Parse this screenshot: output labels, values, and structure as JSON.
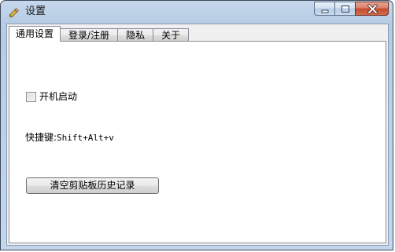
{
  "window": {
    "title": "设置",
    "icon": "pencil-icon",
    "controls": {
      "minimize": "minimize-icon",
      "maximize": "maximize-icon",
      "close": "close-icon"
    }
  },
  "tabs": [
    {
      "label": "通用设置",
      "active": true
    },
    {
      "label": "登录/注册",
      "active": false
    },
    {
      "label": "隐私",
      "active": false
    },
    {
      "label": "关于",
      "active": false
    }
  ],
  "general": {
    "autostart_label": "开机启动",
    "autostart_checked": false,
    "hotkey_label": "快捷键:",
    "hotkey_value": "Shift+Alt+v",
    "clear_history_button": "清空剪贴板历史记录"
  },
  "colors": {
    "close_button": "#c44a2f",
    "panel_background": "#ffffff",
    "frame": "#b7cce4"
  }
}
